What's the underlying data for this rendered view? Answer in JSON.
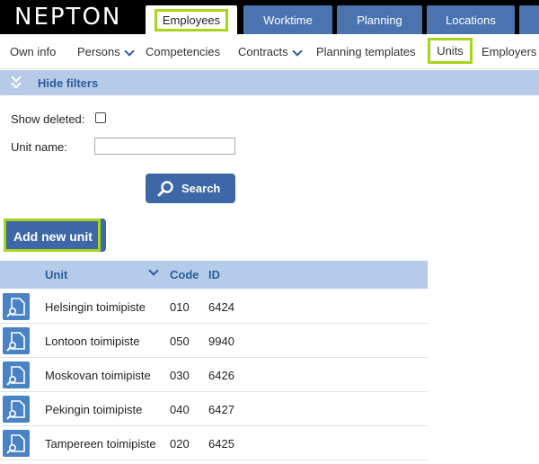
{
  "app": {
    "logo": "NEPTON"
  },
  "main_tabs": [
    {
      "label": "Employees",
      "active": true
    },
    {
      "label": "Worktime"
    },
    {
      "label": "Planning"
    },
    {
      "label": "Locations"
    }
  ],
  "sub_nav": [
    {
      "label": "Own info"
    },
    {
      "label": "Persons",
      "dropdown": true
    },
    {
      "label": "Competencies"
    },
    {
      "label": "Contracts",
      "dropdown": true
    },
    {
      "label": "Planning templates"
    },
    {
      "label": "Units",
      "active": true
    },
    {
      "label": "Employers"
    }
  ],
  "filters": {
    "toggle_label": "Hide filters",
    "show_deleted_label": "Show deleted:",
    "show_deleted_checked": false,
    "unit_name_label": "Unit name:",
    "unit_name_value": "",
    "search_label": "Search"
  },
  "add_button_label": "Add new unit",
  "table": {
    "columns": [
      "Unit",
      "Code",
      "ID"
    ],
    "rows": [
      {
        "unit": "Helsingin toimipiste",
        "code": "010",
        "id": "6424"
      },
      {
        "unit": "Lontoon toimipiste",
        "code": "050",
        "id": "9940"
      },
      {
        "unit": "Moskovan toimipiste",
        "code": "030",
        "id": "6426"
      },
      {
        "unit": "Pekingin toimipiste",
        "code": "040",
        "id": "6427"
      },
      {
        "unit": "Tampereen toimipiste",
        "code": "020",
        "id": "6425"
      }
    ]
  },
  "colors": {
    "accent_blue": "#3d67a6",
    "tab_blue": "#4a74b0",
    "header_light_blue": "#b5cbe8",
    "highlight_green": "#a8d41a"
  }
}
